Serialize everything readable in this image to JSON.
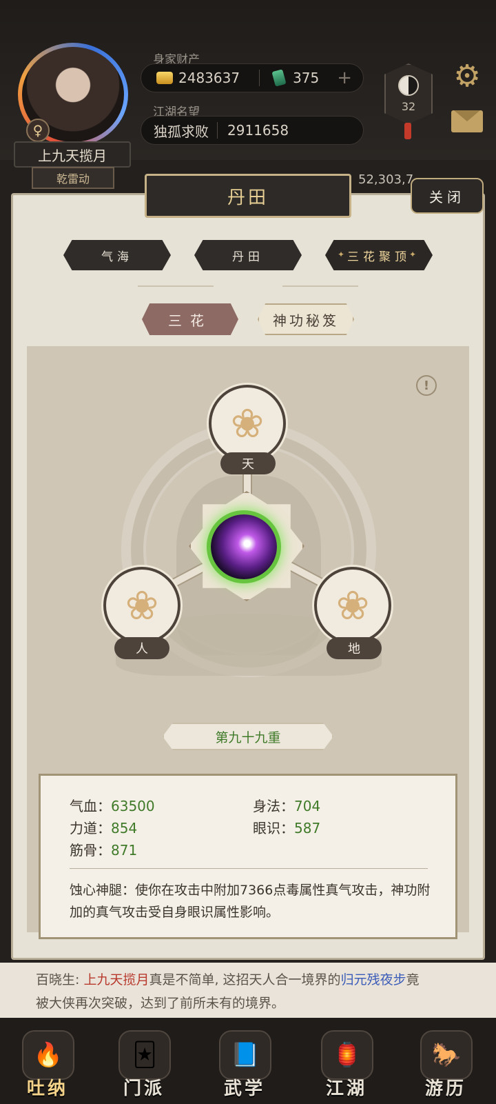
{
  "header": {
    "player_name": "上九天揽月",
    "sub_title": "乾雷动",
    "gender_symbol": "♀",
    "wealth_label": "身家财产",
    "gold_amount": "2483637",
    "jade_amount": "375",
    "plus_symbol": "+",
    "reputation_label": "江湖名望",
    "reputation_title": "独孤求败",
    "reputation_value": "2911658",
    "level_badge": "32",
    "background_number": "52,303,7..."
  },
  "panel": {
    "title": "丹田",
    "close_label": "关闭",
    "tabs": [
      {
        "label": "气海"
      },
      {
        "label": "丹田"
      },
      {
        "label": "三花聚顶"
      }
    ],
    "subtabs": [
      {
        "label": "三花"
      },
      {
        "label": "神功秘笈"
      }
    ],
    "info_symbol": "!",
    "nodes": {
      "top": "天",
      "left": "人",
      "right": "地"
    },
    "level": "第九十九重",
    "stats": {
      "hp_label": "气血：",
      "hp_value": "63500",
      "agility_label": "身法：",
      "agility_value": "704",
      "strength_label": "力道：",
      "strength_value": "854",
      "insight_label": "眼识：",
      "insight_value": "587",
      "bone_label": "筋骨：",
      "bone_value": "871"
    },
    "description": "蚀心神腿：使你在攻击中附加7366点毒属性真气攻击，神功附加的真气攻击受自身眼识属性影响。"
  },
  "chat": {
    "speaker": "百晓生: ",
    "player": "上九天揽月",
    "mid_text": "真是不简单, 这招天人合一境界的",
    "skill": "归元残夜步",
    "end_text": "竟",
    "line2": "被大侠再次突破，达到了前所未有的境界。"
  },
  "nav": [
    {
      "label": "吐纳",
      "icon": "🔥"
    },
    {
      "label": "门派",
      "icon": "🃏"
    },
    {
      "label": "武学",
      "icon": "📘"
    },
    {
      "label": "江湖",
      "icon": "🏮"
    },
    {
      "label": "游历",
      "icon": "🐎"
    }
  ],
  "colors": {
    "accent_gold": "#c9aa6a",
    "value_green": "#3f7a29",
    "dark_plate": "#2d2a27",
    "chat_red": "#b8382c",
    "chat_blue": "#3a5bb8"
  }
}
